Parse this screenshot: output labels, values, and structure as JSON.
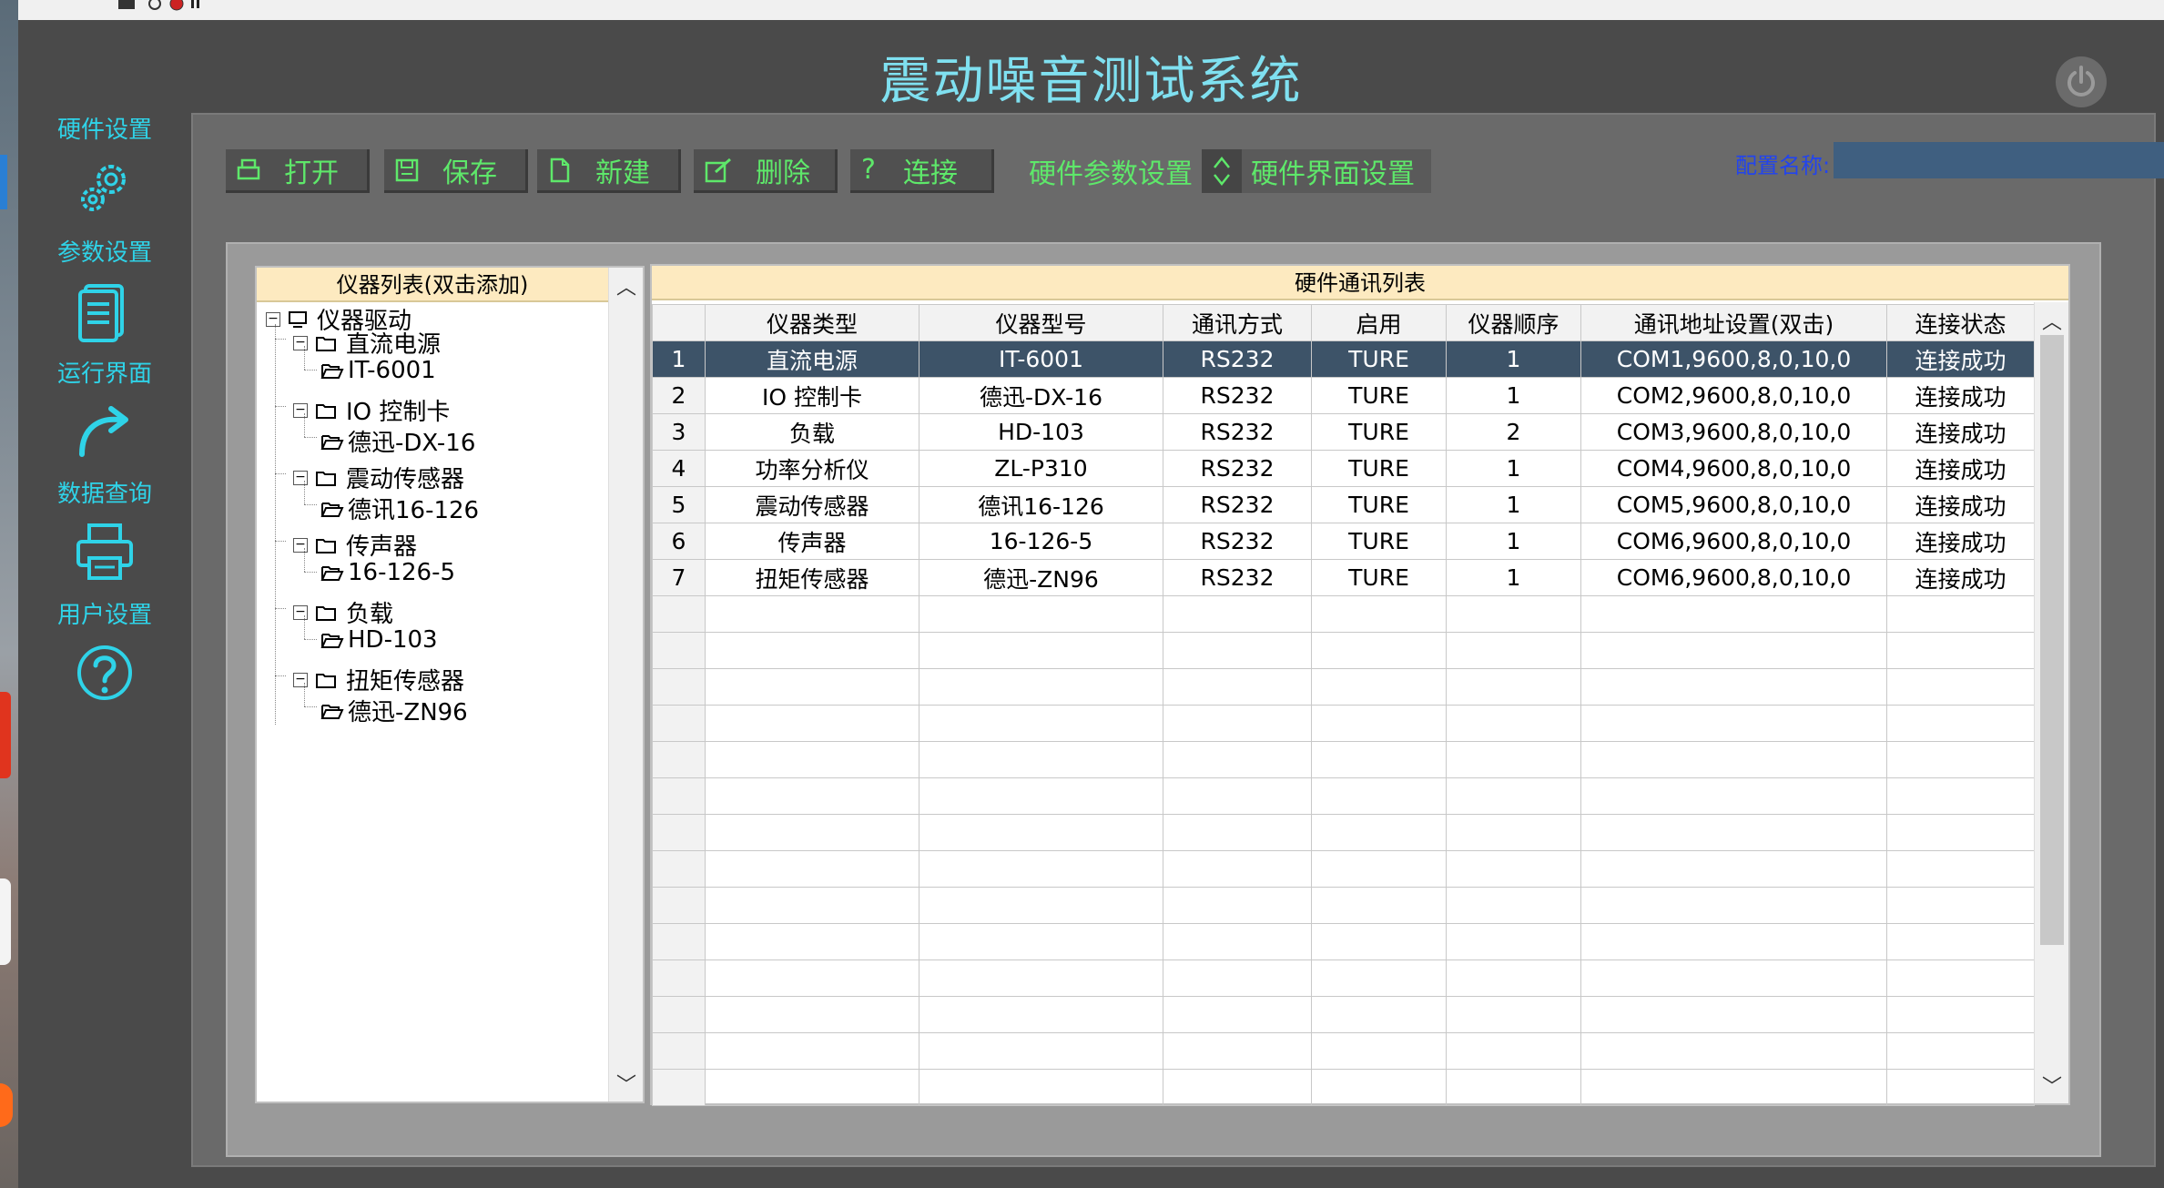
{
  "app": {
    "title": "震动噪音测试系统"
  },
  "nav": [
    {
      "label": "硬件设置",
      "icon": "gears-icon"
    },
    {
      "label": "参数设置",
      "icon": "document-icon"
    },
    {
      "label": "运行界面",
      "icon": "redo-arrow-icon"
    },
    {
      "label": "数据查询",
      "icon": "printer-icon"
    },
    {
      "label": "用户设置",
      "icon": "help-circle-icon"
    }
  ],
  "toolbar": {
    "open_label": "打开",
    "save_label": "保存",
    "new_label": "新建",
    "delete_label": "删除",
    "connect_label": "连接",
    "hw_param_link": "硬件参数设置",
    "hw_ui_label": "硬件界面设置",
    "config_name_label": "配置名称:",
    "config_name_value": ""
  },
  "tree": {
    "header": "仪器列表(双击添加)",
    "root": "仪器驱动",
    "groups": [
      {
        "name": "直流电源",
        "child": "IT-6001"
      },
      {
        "name": "IO 控制卡",
        "child": "德迅-DX-16"
      },
      {
        "name": "震动传感器",
        "child": "德讯16-126"
      },
      {
        "name": "传声器",
        "child": "16-126-5"
      },
      {
        "name": "负载",
        "child": "HD-103"
      },
      {
        "name": "扭矩传感器",
        "child": "德迅-ZN96"
      }
    ]
  },
  "grid": {
    "title": "硬件通讯列表",
    "columns": [
      "",
      "仪器类型",
      "仪器型号",
      "通讯方式",
      "启用",
      "仪器顺序",
      "通讯地址设置(双击)",
      "连接状态"
    ],
    "rows": [
      [
        "1",
        "直流电源",
        "IT-6001",
        "RS232",
        "TURE",
        "1",
        "COM1,9600,8,0,10,0",
        "连接成功"
      ],
      [
        "2",
        "IO 控制卡",
        "德迅-DX-16",
        "RS232",
        "TURE",
        "1",
        "COM2,9600,8,0,10,0",
        "连接成功"
      ],
      [
        "3",
        "负载",
        "HD-103",
        "RS232",
        "TURE",
        "2",
        "COM3,9600,8,0,10,0",
        "连接成功"
      ],
      [
        "4",
        "功率分析仪",
        "ZL-P310",
        "RS232",
        "TURE",
        "1",
        "COM4,9600,8,0,10,0",
        "连接成功"
      ],
      [
        "5",
        "震动传感器",
        "德讯16-126",
        "RS232",
        "TURE",
        "1",
        "COM5,9600,8,0,10,0",
        "连接成功"
      ],
      [
        "6",
        "传声器",
        "16-126-5",
        "RS232",
        "TURE",
        "1",
        "COM6,9600,8,0,10,0",
        "连接成功"
      ],
      [
        "7",
        "扭矩传感器",
        "德迅-ZN96",
        "RS232",
        "TURE",
        "1",
        "COM6,9600,8,0,10,0",
        "连接成功"
      ]
    ],
    "selected_row": 0,
    "empty_rows": 14
  },
  "colors": {
    "title": "#7fe0f0",
    "nav_text": "#2fd3e8",
    "toolbar_text": "#5ee86a",
    "header_bg": "#fdeac0",
    "selected_row": "#3d5368"
  }
}
